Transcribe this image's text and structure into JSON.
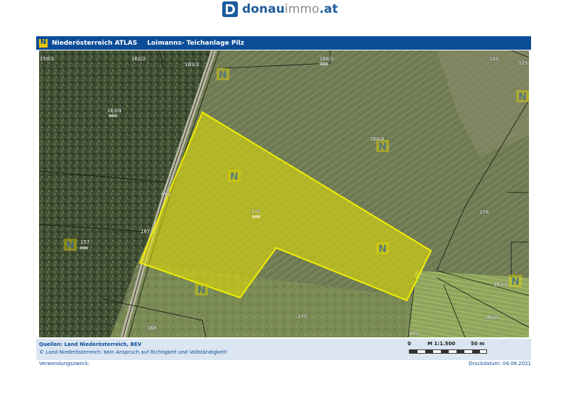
{
  "logo": {
    "brand_left": "donau",
    "brand_mid": "immo",
    "brand_right": ".at"
  },
  "titlebar": {
    "atlas": "Niederösterreich ATLAS",
    "subject": "Loimanns- Teichanlage Pilz"
  },
  "map": {
    "parcel_labels": [
      "159/2",
      "162/2",
      "163/3",
      "164/2",
      "124",
      "125",
      "163/4",
      "164/4",
      "603",
      "174",
      "178",
      "167",
      "157",
      "175",
      "168",
      "163/4",
      "163/1",
      "179"
    ],
    "overlay_color": "#e8e400",
    "n_icon_text": "N"
  },
  "footer": {
    "sources": "Quellen: Land Niederösterreich, BEV",
    "copyright": "© Land Niederösterreich: Kein Anspruch auf Richtigkeit und Vollständigkeit!",
    "scale_zero": "0",
    "scale_ratio": "M 1:1.500",
    "scale_end": "50 m"
  },
  "below": {
    "purpose_label": "Verwendungszweck:",
    "print_date": "Druckdatum: 04.08.2021"
  },
  "colors": {
    "accent": "#0b4c97",
    "brand": "#1c5c9c",
    "highlight": "#e8e400"
  }
}
